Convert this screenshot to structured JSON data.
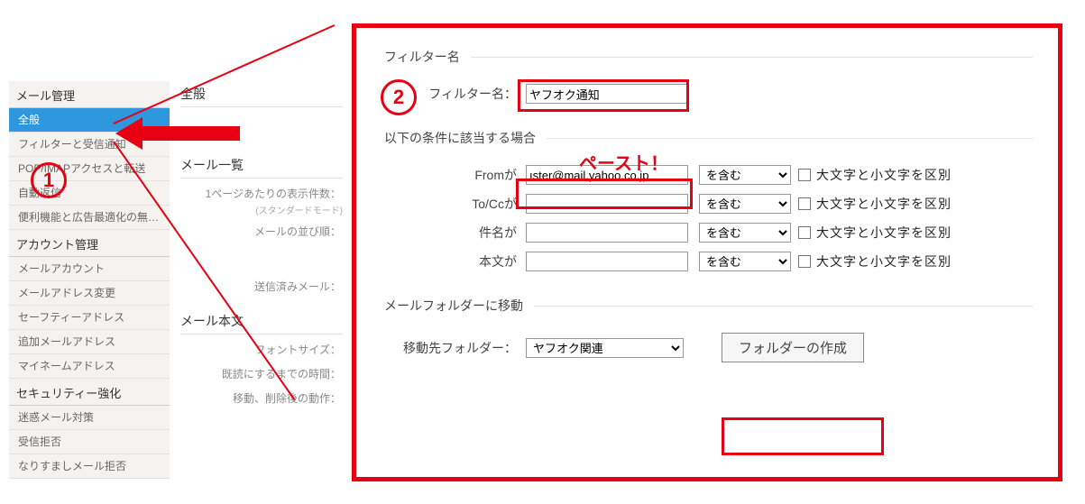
{
  "sidebar": {
    "sections": [
      {
        "title": "メール管理",
        "items": [
          {
            "label": "全般",
            "active": true
          },
          {
            "label": "フィルターと受信通知"
          },
          {
            "label": "POP/IMAPアクセスと転送"
          },
          {
            "label": "自動返信"
          },
          {
            "label": "便利機能と広告最適化の無…"
          }
        ]
      },
      {
        "title": "アカウント管理",
        "items": [
          {
            "label": "メールアカウント"
          },
          {
            "label": "メールアドレス変更"
          },
          {
            "label": "セーフティーアドレス"
          },
          {
            "label": "追加メールアドレス"
          },
          {
            "label": "マイネームアドレス"
          }
        ]
      },
      {
        "title": "セキュリティー強化",
        "items": [
          {
            "label": "迷惑メール対策"
          },
          {
            "label": "受信拒否"
          },
          {
            "label": "なりすましメール拒否"
          }
        ]
      }
    ]
  },
  "midcol": {
    "heading0": "全般",
    "heading1": "メール一覧",
    "line1": "1ページあたりの表示件数：",
    "line1sub": "(スタンダードモード)",
    "line2": "メールの並び順：",
    "line3": "送信済みメール：",
    "heading2": "メール本文",
    "line4": "フォントサイズ：",
    "line5": "既読にするまでの時間：",
    "line6": "移動、削除後の動作："
  },
  "filter": {
    "legend_name": "フィルター名",
    "label_name": "フィルター名：",
    "value_name": "ヤフオク通知",
    "legend_cond": "以下の条件に該当する場合",
    "rows": [
      {
        "label": "Fromが",
        "value": "ıster@mail.yahoo.co.jp"
      },
      {
        "label": "To/Ccが",
        "value": ""
      },
      {
        "label": "件名が",
        "value": ""
      },
      {
        "label": "本文が",
        "value": ""
      }
    ],
    "select_contain": "を含む",
    "chk_label": "大文字と小文字を区別",
    "legend_move": "メールフォルダーに移動",
    "label_move": "移動先フォルダー：",
    "folder_value": "ヤフオク関連",
    "btn_create": "フォルダーの作成"
  },
  "annotations": {
    "step1": "1",
    "step2": "2",
    "paste": "ペースト！"
  }
}
